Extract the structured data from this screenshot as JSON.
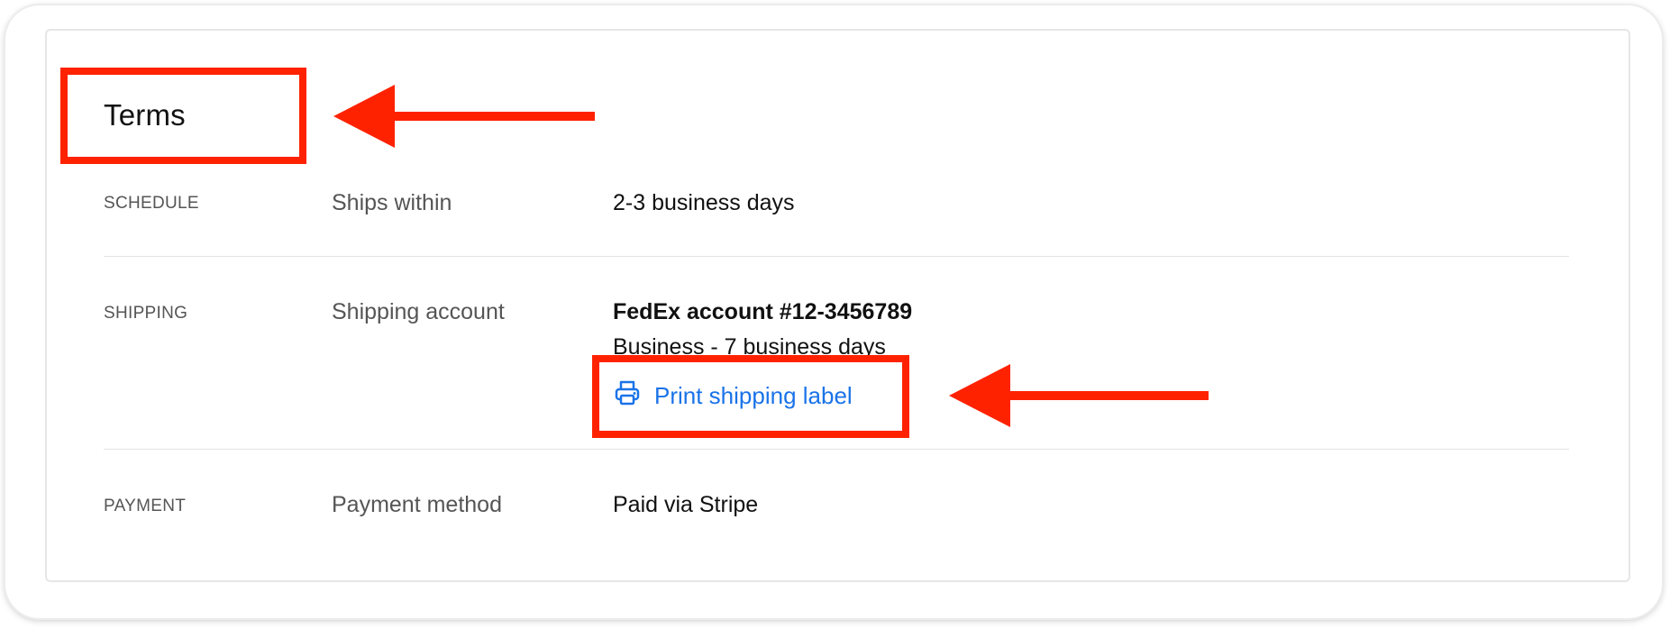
{
  "terms": {
    "title": "Terms"
  },
  "rows": [
    {
      "section": "SCHEDULE",
      "label": "Ships within",
      "value": "2-3 business days"
    },
    {
      "section": "SHIPPING",
      "label": "Shipping account",
      "value": "FedEx account #12-3456789",
      "sub_value": "Business - 7 business days",
      "link_label": "Print shipping label"
    },
    {
      "section": "PAYMENT",
      "label": "Payment method",
      "value": "Paid via Stripe"
    }
  ],
  "icons": {
    "print": "printer-icon"
  },
  "colors": {
    "annotation": "#ff2200",
    "link": "#1a73e8",
    "text": "#111111",
    "muted_text": "#555555",
    "divider": "#e3e3e3"
  }
}
